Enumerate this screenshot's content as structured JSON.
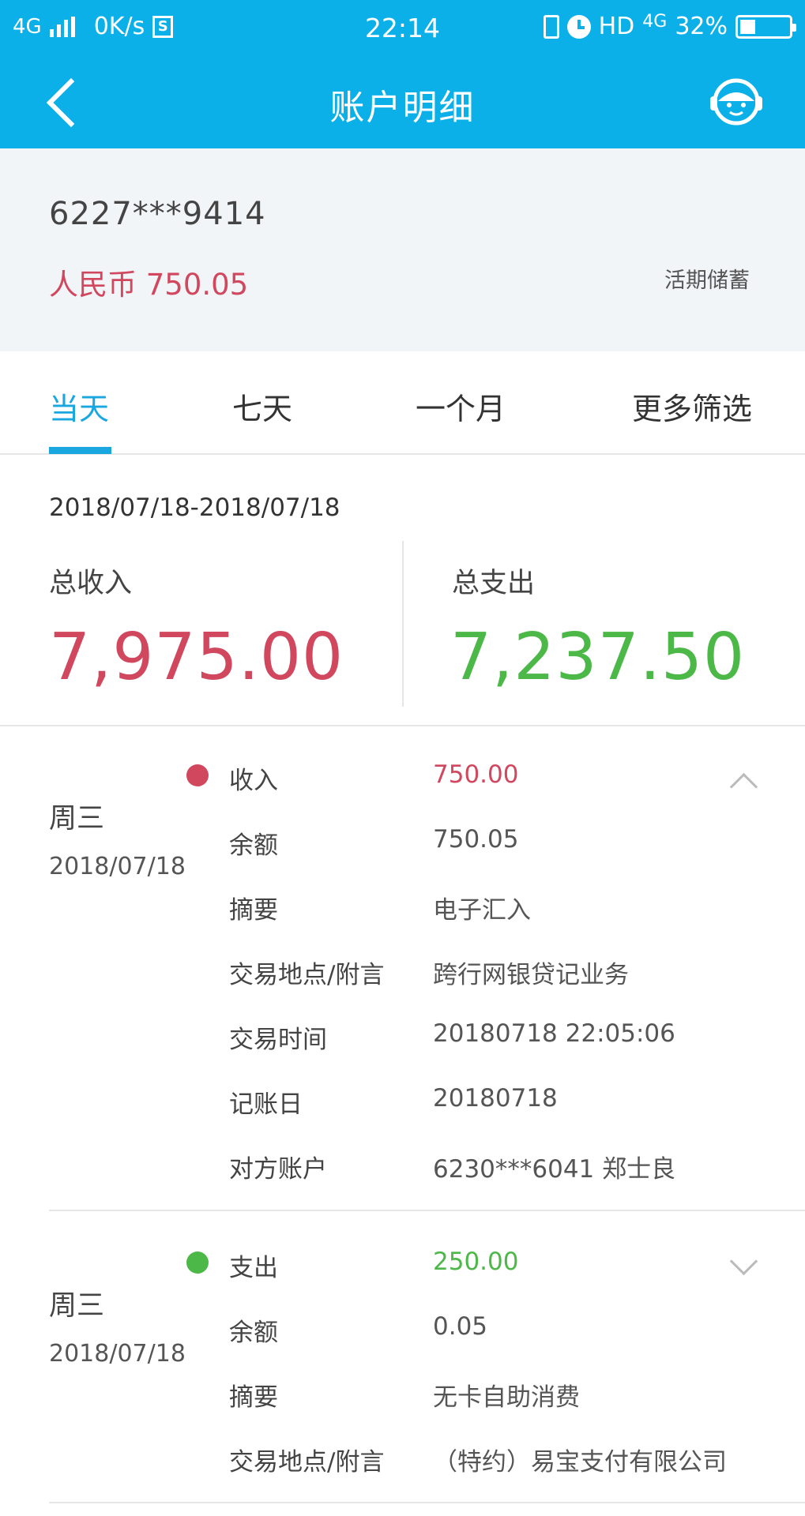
{
  "status_bar": {
    "network": "4G",
    "speed": "0K/s",
    "sync_badge": "S",
    "time": "22:14",
    "hd": "HD",
    "net_right": "4G",
    "battery": "32%",
    "battery_level": 0.32,
    "icons": [
      "signal-icon",
      "sync-icon",
      "vibrate-icon",
      "alarm-icon",
      "battery-icon"
    ]
  },
  "header": {
    "title": "账户明细",
    "icons": [
      "back-icon",
      "customer-service-icon"
    ]
  },
  "account": {
    "number": "6227***9414",
    "balance": "人民币 750.05",
    "type": "活期储蓄"
  },
  "tabs": [
    {
      "label": "当天",
      "active": true
    },
    {
      "label": "七天",
      "active": false
    },
    {
      "label": "一个月",
      "active": false
    },
    {
      "label": "更多筛选",
      "active": false
    }
  ],
  "summary": {
    "date_range": "2018/07/18-2018/07/18",
    "income_label": "总收入",
    "income_value": "7,975.00",
    "expense_label": "总支出",
    "expense_value": "7,237.50"
  },
  "colors": {
    "brand": "#0cb0e8",
    "active_tab": "#1aa7e0",
    "income": "#d0475e",
    "expense": "#4cb848"
  },
  "transactions": [
    {
      "weekday": "周三",
      "date": "2018/07/18",
      "kind": "income",
      "expanded": true,
      "rows": [
        {
          "key": "收入",
          "value": "750.00"
        },
        {
          "key": "余额",
          "value": "750.05"
        },
        {
          "key": "摘要",
          "value": "电子汇入"
        },
        {
          "key": "交易地点/附言",
          "value": "跨行网银贷记业务"
        },
        {
          "key": "交易时间",
          "value": "20180718 22:05:06"
        },
        {
          "key": "记账日",
          "value": "20180718"
        },
        {
          "key": "对方账户",
          "value": "6230***6041 郑士良"
        }
      ]
    },
    {
      "weekday": "周三",
      "date": "2018/07/18",
      "kind": "expense",
      "expanded": false,
      "rows": [
        {
          "key": "支出",
          "value": "250.00"
        },
        {
          "key": "余额",
          "value": "0.05"
        },
        {
          "key": "摘要",
          "value": "无卡自助消费"
        },
        {
          "key": "交易地点/附言",
          "value": "（特约）易宝支付有限公司"
        }
      ]
    }
  ]
}
